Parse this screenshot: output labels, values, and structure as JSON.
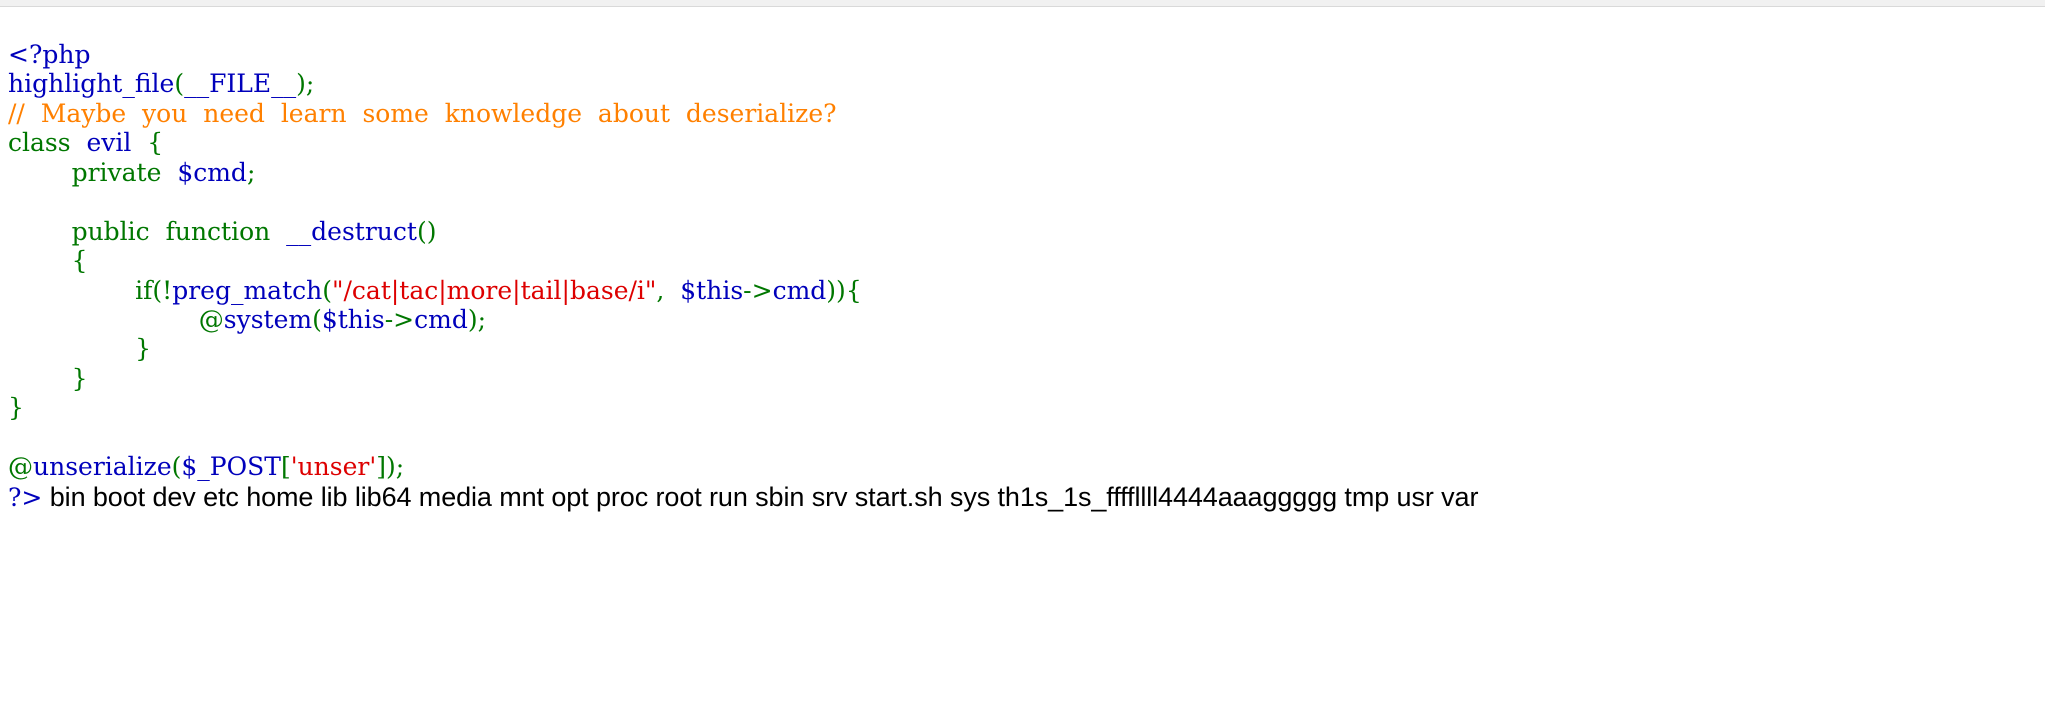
{
  "window": {
    "chrome_strip": true,
    "background_color": "#ffffff"
  },
  "syntax_colors": {
    "default": "#0000BB",
    "keyword": "#007700",
    "string": "#DD0000",
    "comment": "#FF8000",
    "html": "#000000"
  },
  "source": {
    "language": "php",
    "renderer": "highlight_file",
    "lines": [
      {
        "id": "line-1",
        "tokens": [
          {
            "text": "<?php",
            "type": "default"
          }
        ]
      },
      {
        "id": "line-2",
        "tokens": [
          {
            "text": "highlight_file",
            "type": "default"
          },
          {
            "text": "(",
            "type": "keyword"
          },
          {
            "text": "__FILE__",
            "type": "default"
          },
          {
            "text": ");",
            "type": "keyword"
          }
        ]
      },
      {
        "id": "line-3",
        "tokens": [
          {
            "text": "//  Maybe  you  need  learn  some  knowledge  about  deserialize?",
            "type": "comment"
          }
        ]
      },
      {
        "id": "line-4",
        "tokens": [
          {
            "text": "class",
            "type": "keyword"
          },
          {
            "text": "  ",
            "type": "html"
          },
          {
            "text": "evil",
            "type": "default"
          },
          {
            "text": "  ",
            "type": "html"
          },
          {
            "text": "{",
            "type": "keyword"
          }
        ]
      },
      {
        "id": "line-5",
        "tokens": [
          {
            "text": "        ",
            "type": "html"
          },
          {
            "text": "private",
            "type": "keyword"
          },
          {
            "text": "  ",
            "type": "html"
          },
          {
            "text": "$cmd",
            "type": "default"
          },
          {
            "text": ";",
            "type": "keyword"
          }
        ]
      },
      {
        "id": "line-6",
        "tokens": []
      },
      {
        "id": "line-7",
        "tokens": [
          {
            "text": "        ",
            "type": "html"
          },
          {
            "text": "public",
            "type": "keyword"
          },
          {
            "text": "  ",
            "type": "html"
          },
          {
            "text": "function",
            "type": "keyword"
          },
          {
            "text": "  ",
            "type": "html"
          },
          {
            "text": "__destruct",
            "type": "default"
          },
          {
            "text": "()",
            "type": "keyword"
          }
        ]
      },
      {
        "id": "line-8",
        "tokens": [
          {
            "text": "        ",
            "type": "html"
          },
          {
            "text": "{",
            "type": "keyword"
          }
        ]
      },
      {
        "id": "line-9",
        "tokens": [
          {
            "text": "                ",
            "type": "html"
          },
          {
            "text": "if",
            "type": "keyword"
          },
          {
            "text": "(!",
            "type": "keyword"
          },
          {
            "text": "preg_match",
            "type": "default"
          },
          {
            "text": "(",
            "type": "keyword"
          },
          {
            "text": "\"/cat|tac|more|tail|base/i\"",
            "type": "string"
          },
          {
            "text": ",",
            "type": "keyword"
          },
          {
            "text": "  ",
            "type": "html"
          },
          {
            "text": "$this",
            "type": "default"
          },
          {
            "text": "->",
            "type": "keyword"
          },
          {
            "text": "cmd",
            "type": "default"
          },
          {
            "text": "))",
            "type": "keyword"
          },
          {
            "text": "{",
            "type": "keyword"
          }
        ]
      },
      {
        "id": "line-10",
        "tokens": [
          {
            "text": "                        ",
            "type": "html"
          },
          {
            "text": "@",
            "type": "keyword"
          },
          {
            "text": "system",
            "type": "default"
          },
          {
            "text": "(",
            "type": "keyword"
          },
          {
            "text": "$this",
            "type": "default"
          },
          {
            "text": "->",
            "type": "keyword"
          },
          {
            "text": "cmd",
            "type": "default"
          },
          {
            "text": ");",
            "type": "keyword"
          }
        ]
      },
      {
        "id": "line-11",
        "tokens": [
          {
            "text": "                ",
            "type": "html"
          },
          {
            "text": "}",
            "type": "keyword"
          }
        ]
      },
      {
        "id": "line-12",
        "tokens": [
          {
            "text": "        ",
            "type": "html"
          },
          {
            "text": "}",
            "type": "keyword"
          }
        ]
      },
      {
        "id": "line-13",
        "tokens": [
          {
            "text": "}",
            "type": "keyword"
          }
        ]
      },
      {
        "id": "line-14",
        "tokens": []
      },
      {
        "id": "line-15",
        "tokens": [
          {
            "text": "@",
            "type": "keyword"
          },
          {
            "text": "unserialize",
            "type": "default"
          },
          {
            "text": "(",
            "type": "keyword"
          },
          {
            "text": "$_POST",
            "type": "default"
          },
          {
            "text": "[",
            "type": "keyword"
          },
          {
            "text": "'unser'",
            "type": "string"
          },
          {
            "text": "]);",
            "type": "keyword"
          }
        ]
      }
    ],
    "closing_tag": "?>"
  },
  "command_output": {
    "text": " bin boot dev etc home lib lib64 media mnt opt proc root run sbin srv start.sh sys th1s_1s_ffffllll4444aaaggggg tmp usr var",
    "entries": [
      "bin",
      "boot",
      "dev",
      "etc",
      "home",
      "lib",
      "lib64",
      "media",
      "mnt",
      "opt",
      "proc",
      "root",
      "run",
      "sbin",
      "srv",
      "start.sh",
      "sys",
      "th1s_1s_ffffllll4444aaaggggg",
      "tmp",
      "usr",
      "var"
    ]
  }
}
